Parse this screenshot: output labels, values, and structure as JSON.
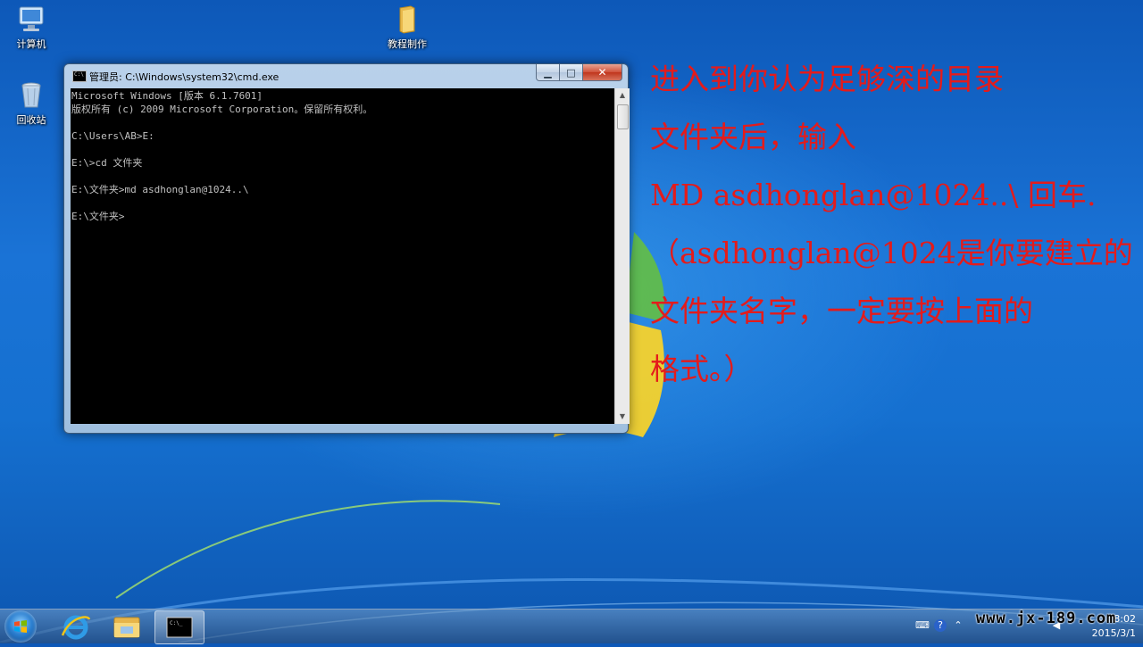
{
  "desktop": {
    "icons": [
      {
        "label": "计算机",
        "icon": "computer-icon"
      },
      {
        "label": "教程制作",
        "icon": "folder-icon"
      },
      {
        "label": "回收站",
        "icon": "recycle-bin-icon"
      }
    ]
  },
  "cmd_window": {
    "title": "管理员: C:\\Windows\\system32\\cmd.exe",
    "console_lines": [
      "Microsoft Windows [版本 6.1.7601]",
      "版权所有 (c) 2009 Microsoft Corporation。保留所有权利。",
      "",
      "C:\\Users\\AB>E:",
      "",
      "E:\\>cd 文件夹",
      "",
      "E:\\文件夹>md asdhonglan@1024..\\",
      "",
      "E:\\文件夹>"
    ],
    "buttons": {
      "minimize": "▁",
      "maximize": "□",
      "close": "✕"
    }
  },
  "annotation": {
    "lines": [
      "进入到你认为足够深的目录",
      "文件夹后，输入",
      "MD asdhonglan@1024..\\ 回车.",
      "（asdhonglan@1024是你要建立的",
      "文件夹名字，一定要按上面的",
      "格式。）"
    ]
  },
  "taskbar": {
    "pinned": [
      {
        "name": "internet-explorer",
        "icon": "ie-icon"
      },
      {
        "name": "explorer",
        "icon": "folder-icon"
      },
      {
        "name": "cmd",
        "icon": "cmd-icon",
        "active": true
      }
    ],
    "clock": {
      "time": "8:02",
      "date": "2015/3/1"
    },
    "watermark": "www.jx-189.com"
  },
  "colors": {
    "annotation": "#e41b1b",
    "console_bg": "#000000",
    "console_fg": "#c0c0c0"
  }
}
